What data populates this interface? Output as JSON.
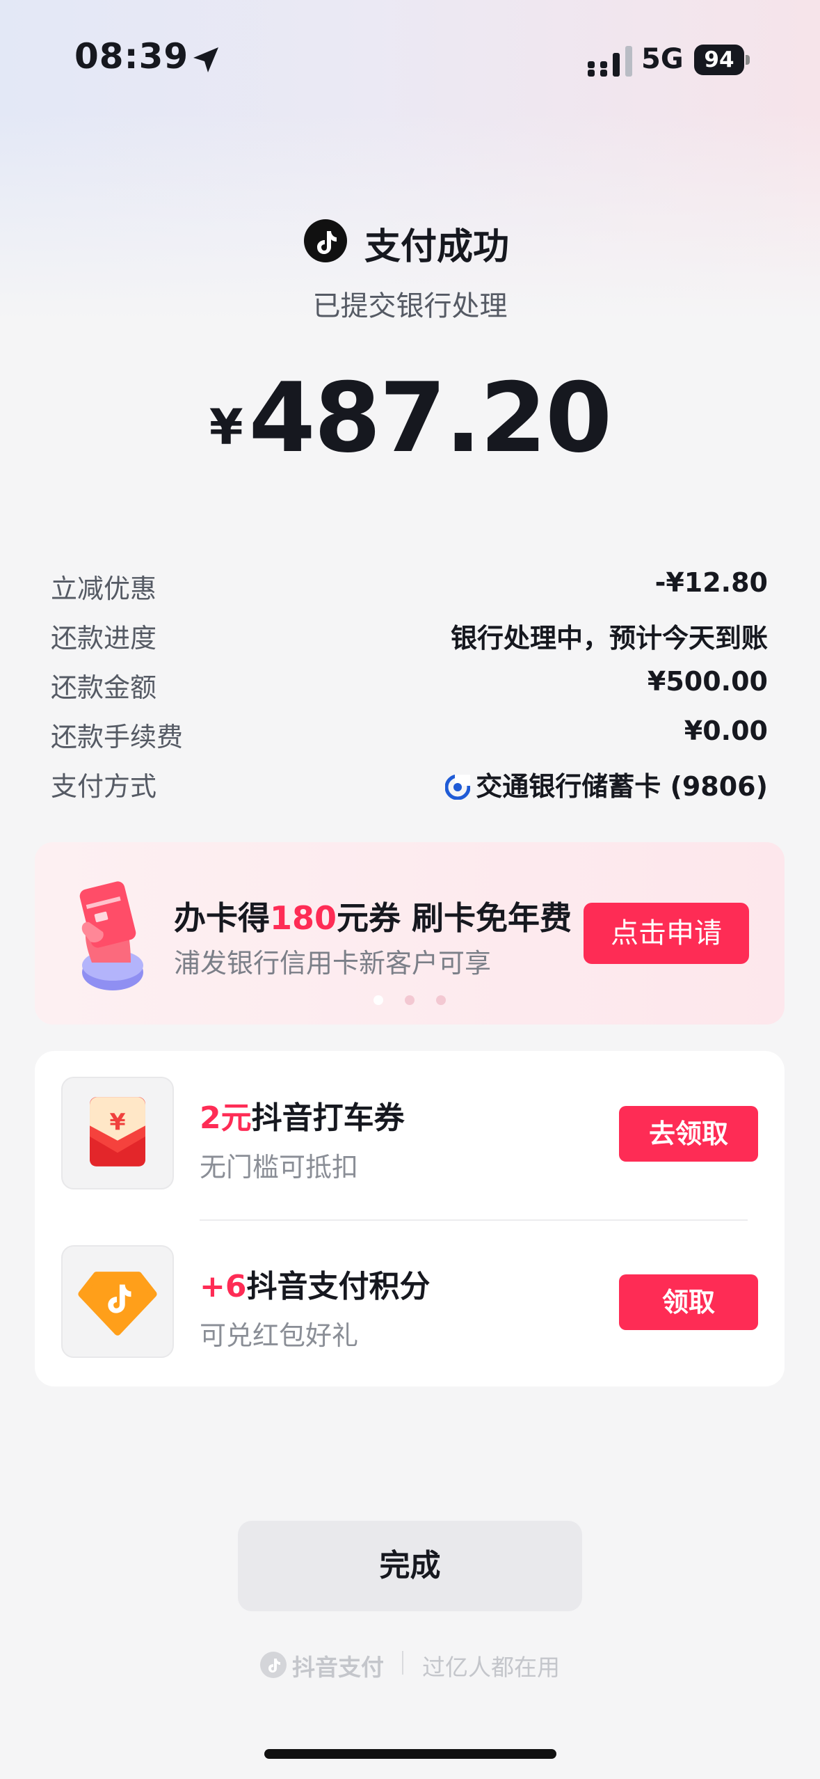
{
  "status_bar": {
    "time": "08:39",
    "network": "5G",
    "battery": "94"
  },
  "header": {
    "title": "支付成功",
    "subtitle": "已提交银行处理",
    "currency": "¥",
    "amount": "487.20"
  },
  "details": [
    {
      "label": "立减优惠",
      "value": "-¥12.80"
    },
    {
      "label": "还款进度",
      "value": "银行处理中，预计今天到账"
    },
    {
      "label": "还款金额",
      "value": "¥500.00"
    },
    {
      "label": "还款手续费",
      "value": "¥0.00"
    },
    {
      "label": "支付方式",
      "value": "交通银行储蓄卡 (9806)"
    }
  ],
  "promo": {
    "title_prefix": "办卡得",
    "title_highlight": "180",
    "title_suffix": "元券 刷卡免年费",
    "subtitle": "浦发银行信用卡新客户可享",
    "button": "点击申请"
  },
  "rewards": [
    {
      "highlight": "2元",
      "title": "抖音打车券",
      "subtitle": "无门槛可抵扣",
      "button": "去领取",
      "icon": "red-envelope-icon"
    },
    {
      "highlight": "+6",
      "title": "抖音支付积分",
      "subtitle": "可兑红包好礼",
      "button": "领取",
      "icon": "points-badge-icon"
    }
  ],
  "footer": {
    "done_button": "完成",
    "brand": "抖音支付",
    "slogan": "过亿人都在用"
  },
  "colors": {
    "accent": "#fe2c55",
    "text": "#16181f",
    "muted": "#555a64",
    "background": "#f5f5f6"
  }
}
